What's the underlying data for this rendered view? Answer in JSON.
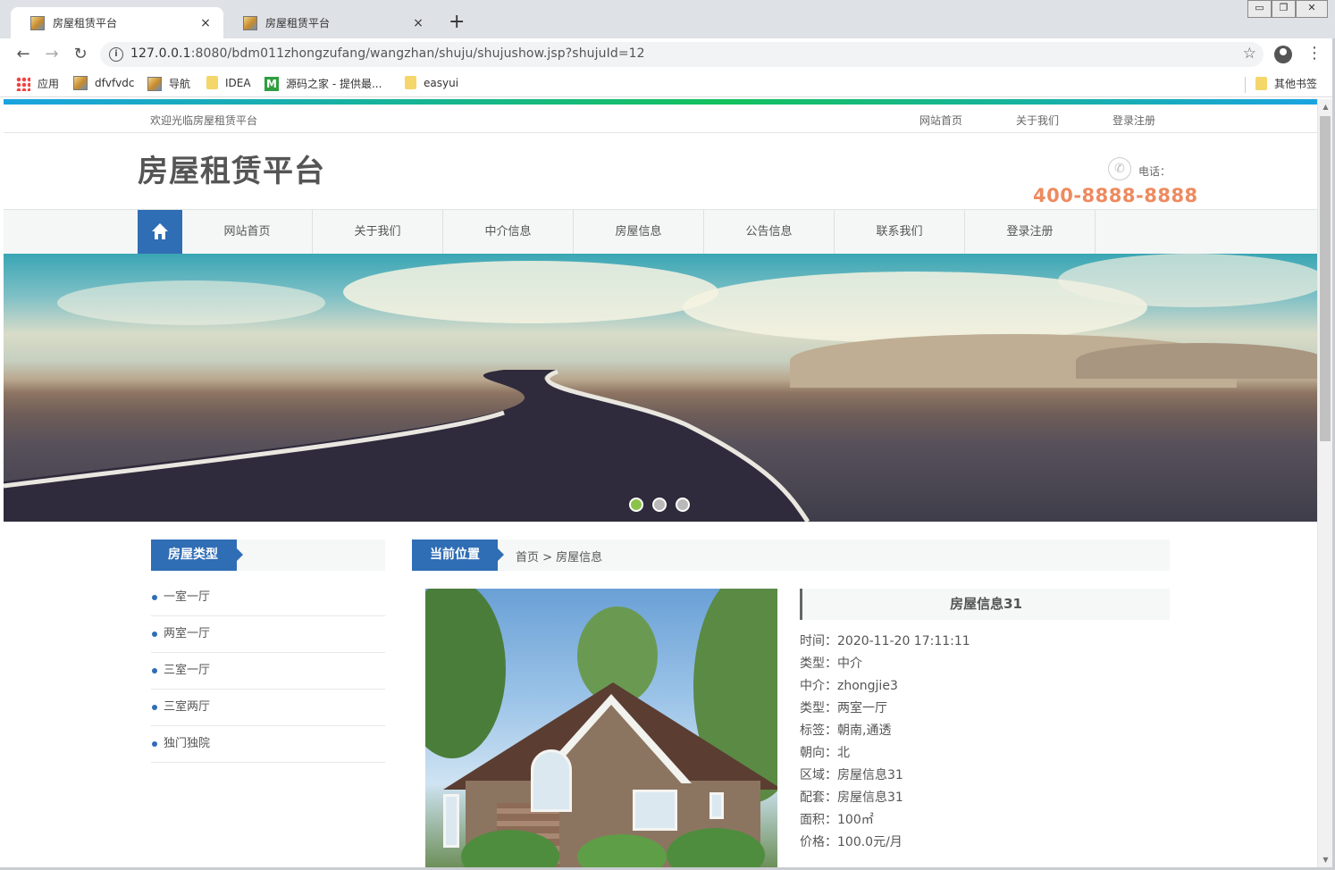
{
  "browser": {
    "tabs": [
      {
        "title": "房屋租赁平台",
        "active": true
      },
      {
        "title": "房屋租赁平台",
        "active": false
      }
    ],
    "new_tab": "+",
    "close_glyph": "×",
    "url_host": "127.0.0.1",
    "url_rest": ":8080/bdm011zhongzufang/wangzhan/shuju/shujushow.jsp?shujuId=12",
    "bookmarks": [
      {
        "label": "应用",
        "icon": "apps-icon"
      },
      {
        "label": "dfvfvdc",
        "icon": "page-icon"
      },
      {
        "label": "导航",
        "icon": "page-icon"
      },
      {
        "label": "IDEA",
        "icon": "folder-icon"
      },
      {
        "label": "源码之家 - 提供最...",
        "icon": "m-icon"
      },
      {
        "label": "easyui",
        "icon": "folder-icon"
      }
    ],
    "other_bookmarks": "其他书签"
  },
  "site": {
    "welcome": "欢迎光临房屋租赁平台",
    "top_links": [
      "网站首页",
      "关于我们",
      "登录注册"
    ],
    "title": "房屋租赁平台",
    "phone_label": "电话：",
    "phone_number": "400-8888-8888",
    "nav": [
      "网站首页",
      "关于我们",
      "中介信息",
      "房屋信息",
      "公告信息",
      "联系我们",
      "登录注册"
    ],
    "accent_color": "#2f6db5",
    "phone_color": "#ee8a5f"
  },
  "sidebar": {
    "heading": "房屋类型",
    "categories": [
      "一室一厅",
      "两室一厅",
      "三室一厅",
      "三室两厅",
      "独门独院"
    ]
  },
  "breadcrumb": {
    "heading": "当前位置",
    "path": "首页 > 房屋信息"
  },
  "detail": {
    "title": "房屋信息31",
    "fields": [
      "时间：2020-11-20 17:11:11",
      "类型：中介",
      "中介：zhongjie3",
      "类型：两室一厅",
      "标签：朝南,通透",
      "朝向：北",
      "区域：房屋信息31",
      "配套：房屋信息31",
      "面积：100㎡",
      "价格：100.0元/月"
    ]
  }
}
